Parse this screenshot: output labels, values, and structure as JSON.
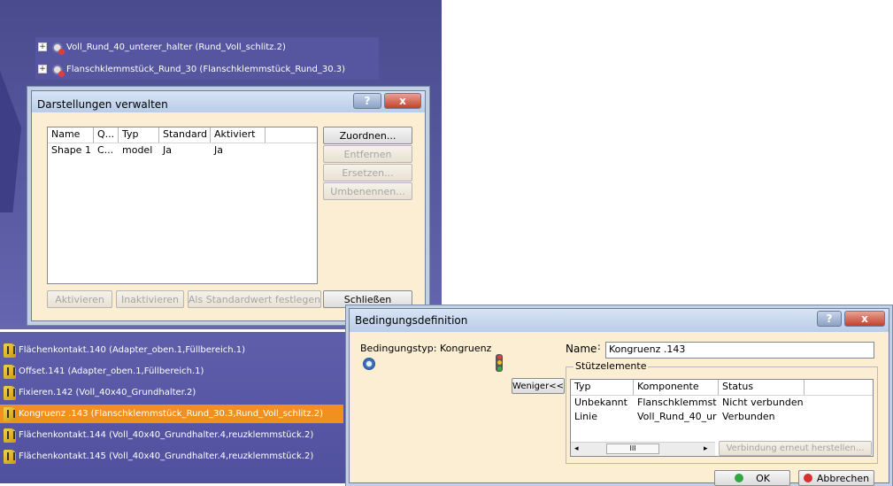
{
  "top_tree": [
    {
      "label": "Voll_Rund_40_unterer_halter (Rund_Voll_schlitz.2)"
    },
    {
      "label": "Flanschklemmstück_Rund_30 (Flanschklemmstück_Rund_30.3)"
    }
  ],
  "darstellungen_dialog": {
    "title": "Darstellungen verwalten",
    "help_btn": "?",
    "close_btn": "x",
    "columns": [
      "Name",
      "Q...",
      "Typ",
      "Standard",
      "Aktiviert"
    ],
    "rows": [
      [
        "Shape 1",
        "C...",
        "model",
        "Ja",
        "Ja"
      ]
    ],
    "side_buttons": [
      {
        "label": "Zuordnen...",
        "enabled": true
      },
      {
        "label": "Entfernen",
        "enabled": false
      },
      {
        "label": "Ersetzen...",
        "enabled": false
      },
      {
        "label": "Umbenennen...",
        "enabled": false
      }
    ],
    "bottom_buttons": {
      "aktivieren": "Aktivieren",
      "inaktivieren": "Inaktivieren",
      "standard": "Als Standardwert festlegen",
      "schliessen": "Schließen"
    }
  },
  "constraint_tree": [
    {
      "label": "Flächenkontakt.140 (Adapter_oben.1,Füllbereich.1)",
      "selected": false
    },
    {
      "label": "Offset.141 (Adapter_oben.1,Füllbereich.1)",
      "selected": false
    },
    {
      "label": "Fixieren.142 (Voll_40x40_Grundhalter.2)",
      "selected": false
    },
    {
      "label": "Kongruenz .143 (Flanschklemmstück_Rund_30.3,Rund_Voll_schlitz.2)",
      "selected": true
    },
    {
      "label": "Flächenkontakt.144 (Voll_40x40_Grundhalter.4,reuzklemmstück.2)",
      "selected": false
    },
    {
      "label": "Flächenkontakt.145 (Voll_40x40_Grundhalter.4,reuzklemmstück.2)",
      "selected": false
    }
  ],
  "bedingung_dialog": {
    "title": "Bedingungsdefinition",
    "help_btn": "?",
    "close_btn": "x",
    "type_label": "Bedingungstyp: Kongruenz",
    "name_label": "Name",
    "name_value": "Kongruenz .143",
    "group_title": "Stützelemente",
    "toggle_btn": "Weniger<<",
    "columns": [
      "Typ",
      "Komponente",
      "Status"
    ],
    "rows": [
      [
        "Unbekannt",
        "Flanschklemmst",
        "Nicht verbunden"
      ],
      [
        "Linie",
        "Voll_Rund_40_ur",
        "Verbunden"
      ]
    ],
    "scroll_thumb": "III",
    "reconnect_btn": "Verbindung erneut herstellen...",
    "ok_btn": "OK",
    "cancel_btn": "Abbrechen"
  }
}
